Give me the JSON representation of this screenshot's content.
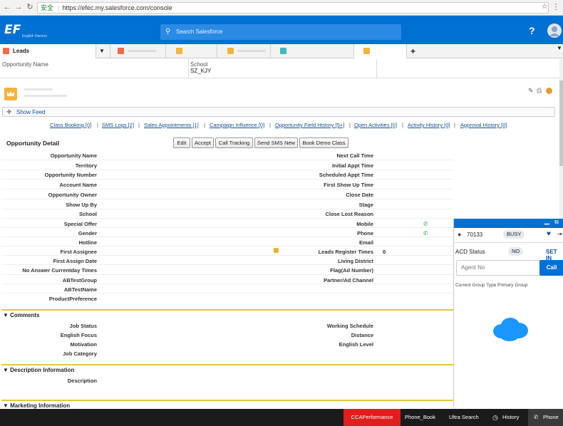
{
  "browser": {
    "url_secure": "安全",
    "url": "https://efec.my.salesforce.com/console"
  },
  "header": {
    "logo": "EF",
    "logo_sub": "English Owners",
    "search_placeholder": "Search Salesforce",
    "help": "?"
  },
  "tabs": {
    "leads_label": "Leads",
    "add": "+"
  },
  "opportunity_row": {
    "opportunity_name_label": "Opportunity Name",
    "school_label": "School",
    "school_value": "SZ_KJY"
  },
  "record": {
    "show_feed": "Show Feed",
    "related_links": [
      {
        "label": "Class Booking",
        "count": "[0]"
      },
      {
        "label": "SMS Logs",
        "count": "[2]"
      },
      {
        "label": "Sales Appointments",
        "count": "[1]"
      },
      {
        "label": "Campaign Influence",
        "count": "[0]"
      },
      {
        "label": "Opportunity Field History",
        "count": "[5+]"
      },
      {
        "label": "Open Activities",
        "count": "[0]"
      },
      {
        "label": "Activity History",
        "count": "[0]"
      },
      {
        "label": "Approval History",
        "count": "[0]"
      }
    ],
    "detail_title": "Opportunity Detail",
    "buttons": [
      "Edit",
      "Accept",
      "Call Tracking",
      "Send SMS New",
      "Book Demo Class"
    ]
  },
  "detail_left_labels": [
    "Opportunity Name",
    "Territory",
    "Opportunity Number",
    "Account Name",
    "Opportunity Owner",
    "Show Up By",
    "School",
    "Special Offer",
    "Gender",
    "Hotline",
    "First Assignee",
    "First Assign Date",
    "No Answer Currentday Times",
    "ABTestGroup",
    "ABTestName",
    "ProductPreference"
  ],
  "detail_right_labels": [
    "Next Call Time",
    "Initial Appt Time",
    "Scheduled Appt Time",
    "First Show Up Time",
    "Close Date",
    "Stage",
    "Close Lost Reason",
    "Mobile",
    "Phone",
    "Email",
    "Leads Register Times",
    "Living District",
    "Flag(Ad Number)",
    "Partner/Ad Channel"
  ],
  "leads_register_times_value": "0",
  "comments": {
    "title": "Comments",
    "left": [
      "Job Status",
      "English Focus",
      "Motivation",
      "Job Category"
    ],
    "right": [
      "Working Schedule",
      "Distance",
      "English Level"
    ]
  },
  "description": {
    "title": "Description Information",
    "label": "Description"
  },
  "marketing": {
    "title": "Marketing Information"
  },
  "phone_panel": {
    "extension": "70133",
    "status": "BUSY",
    "acd_label": "ACD Status",
    "acd_value": "NO",
    "set_label": "SET IN",
    "agent_placeholder": "Agent No",
    "call_label": "Call",
    "group_text": "Current Group Type Primary Group"
  },
  "footer": {
    "items": [
      "CCAPerformance",
      "Phone_Book",
      "Ultra Search",
      "History",
      "Phone"
    ]
  },
  "colors": {
    "brand_blue": "#0070d2",
    "footer_red": "#e01e1e",
    "section_gold": "#e6c44a"
  }
}
